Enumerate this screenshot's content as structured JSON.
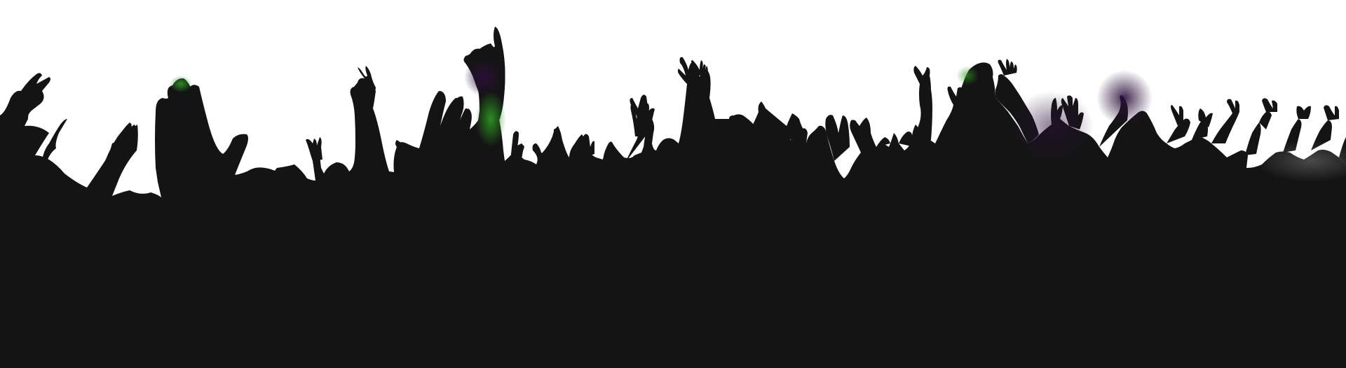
{
  "scene": {
    "subject": "crowd-silhouette-raised-hands",
    "colors": {
      "background": "#ffffff",
      "silhouette": "#141414",
      "glow_green": "#2f9a24",
      "glow_purple": "#2a0f3a"
    }
  }
}
